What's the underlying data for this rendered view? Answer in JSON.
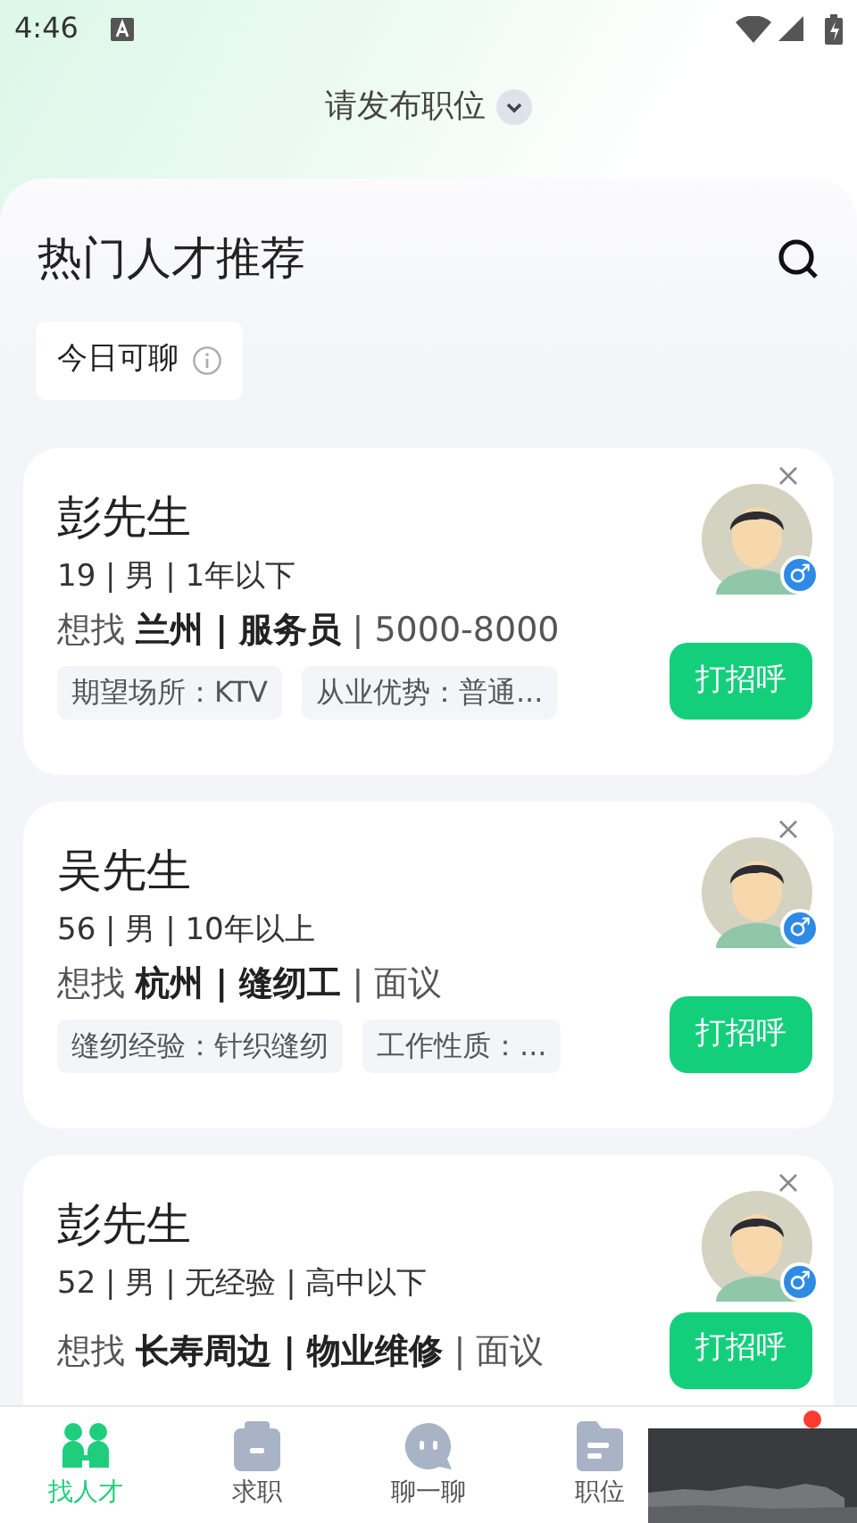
{
  "status_bar": {
    "time": "4:46"
  },
  "header": {
    "title": "请发布职位"
  },
  "section": {
    "title": "热门人才推荐",
    "filter_chip": "今日可聊"
  },
  "candidates": [
    {
      "name": "彭先生",
      "info": "19 | 男 | 1年以下",
      "gender_symbol": "♂",
      "wish": "想找 **兰州 | 服务员** | 5000-8000",
      "tags": [
        "期望场所：KTV",
        "从业优势：普通..."
      ],
      "action": "打招呼"
    },
    {
      "name": "吴先生",
      "info": "56 | 男 | 10年以上",
      "gender_symbol": "♂",
      "wish": "想找 **杭州 | 缝纫工** | 面议",
      "tags": [
        "缝纫经验：针织缝纫",
        "工作性质：..."
      ],
      "action": "打招呼"
    },
    {
      "name": "彭先生",
      "info": "52 | 男 | 无经验 | 高中以下",
      "gender_symbol": "♂",
      "wish": "想找 **长寿周边 | 物业维修** | 面议",
      "action": "打招呼"
    }
  ],
  "bottom_nav": [
    {
      "label": "找人才",
      "selected": true
    },
    {
      "label": "求职",
      "selected": false
    },
    {
      "label": "聊一聊",
      "selected": false
    },
    {
      "label": "职位",
      "selected": false
    }
  ]
}
